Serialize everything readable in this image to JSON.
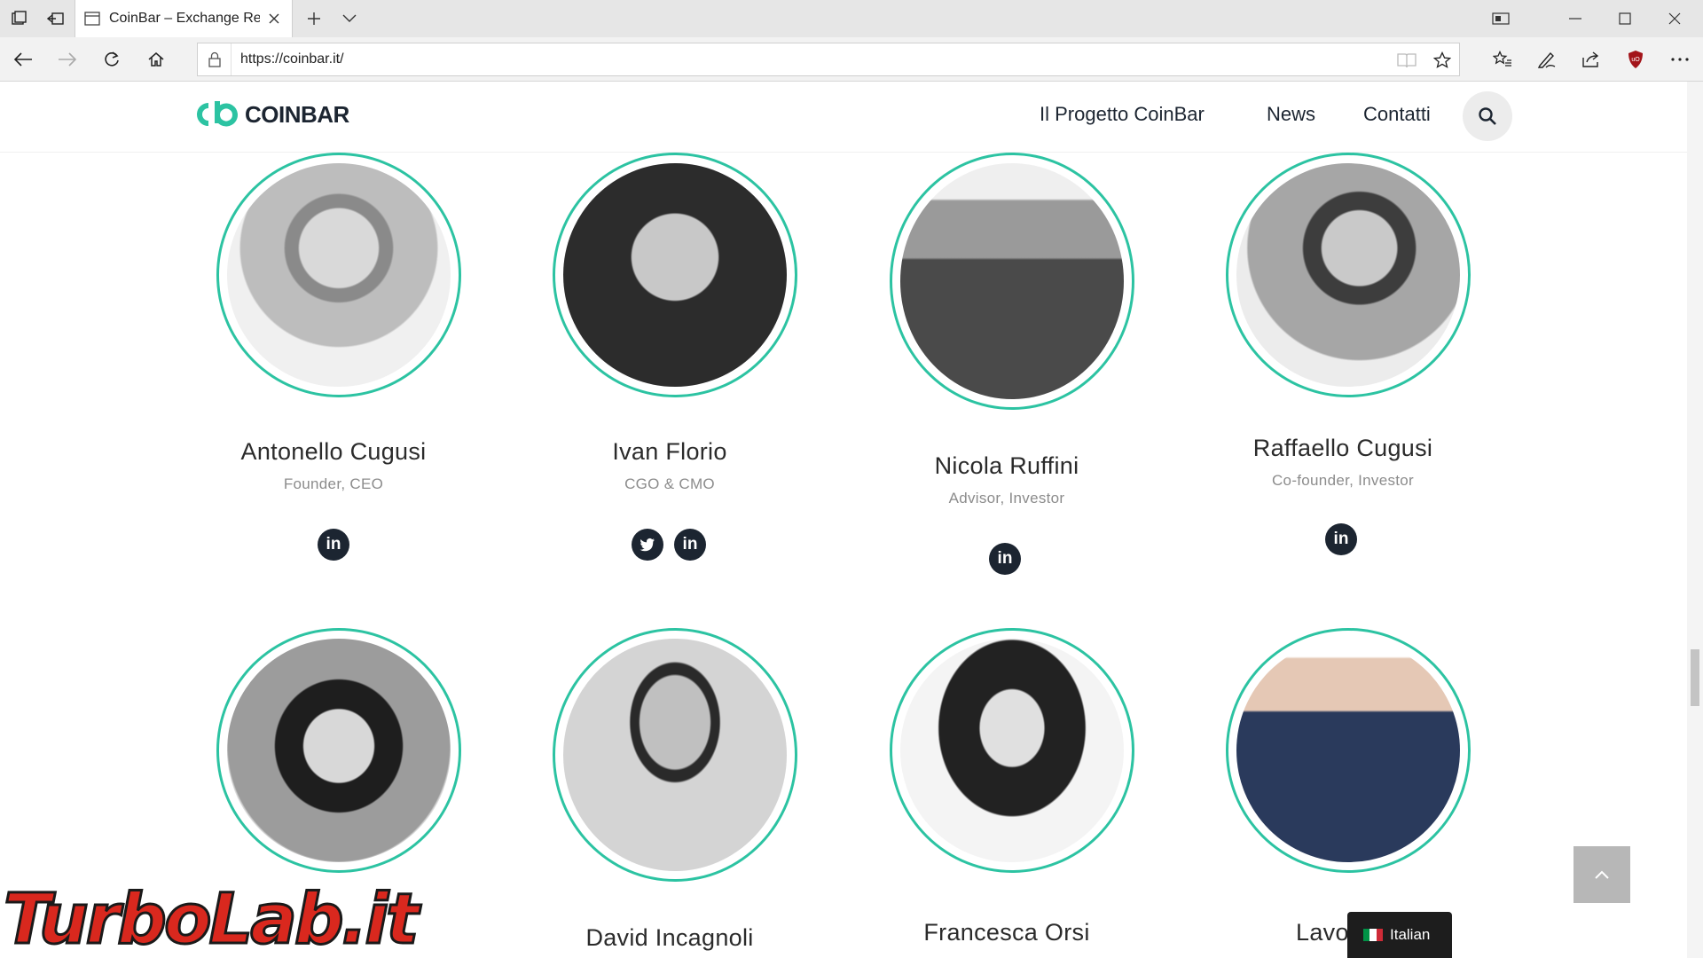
{
  "browser": {
    "tab_title": "CoinBar – Exchange Reg",
    "url": "https://coinbar.it/"
  },
  "site": {
    "logo_text": "COINBAR",
    "brand_color": "#2cc3a2",
    "nav": [
      {
        "label": "Il Progetto CoinBar"
      },
      {
        "label": "News"
      },
      {
        "label": "Contatti"
      }
    ]
  },
  "team": [
    {
      "name": "Antonello Cugusi",
      "role": "Founder, CEO",
      "social": [
        "linkedin"
      ]
    },
    {
      "name": "Ivan Florio",
      "role": "CGO & CMO",
      "social": [
        "twitter",
        "linkedin"
      ]
    },
    {
      "name": "Nicola Ruffini",
      "role": "Advisor, Investor",
      "social": [
        "linkedin"
      ]
    },
    {
      "name": "Raffaello Cugusi",
      "role": "Co-founder, Investor",
      "social": [
        "linkedin"
      ]
    },
    {
      "name": "",
      "role": "",
      "social": []
    },
    {
      "name": "David Incagnoli",
      "role": "",
      "social": []
    },
    {
      "name": "Francesca Orsi",
      "role": "",
      "social": []
    },
    {
      "name": "Lavora c",
      "role": "",
      "social": []
    }
  ],
  "language_switcher": {
    "label": "Italian"
  },
  "watermark": "TurboLab.it"
}
